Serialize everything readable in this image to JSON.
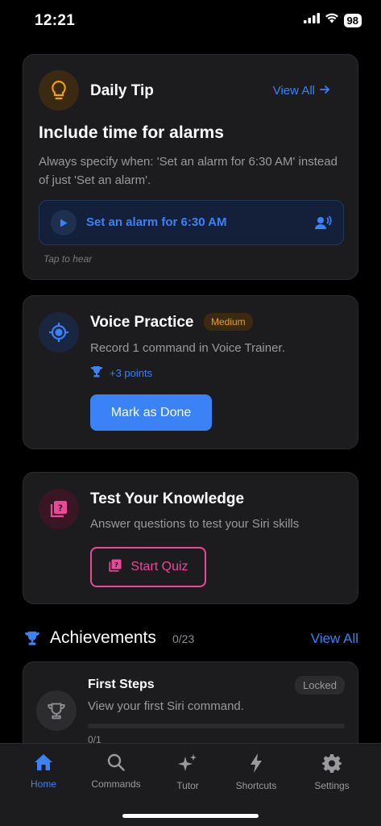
{
  "status": {
    "time": "12:21",
    "battery": "98"
  },
  "daily_tip": {
    "header": "Daily Tip",
    "view_all": "View All",
    "title": "Include time for alarms",
    "description": "Always specify when: 'Set an alarm for 6:30 AM' instead of just 'Set an alarm'.",
    "example": "Set an alarm for 6:30 AM",
    "tap_hint": "Tap to hear"
  },
  "voice_practice": {
    "title": "Voice Practice",
    "difficulty": "Medium",
    "description": "Record 1 command in Voice Trainer.",
    "points": "+3 points",
    "button": "Mark as Done"
  },
  "quiz": {
    "title": "Test Your Knowledge",
    "description": "Answer questions to test your Siri skills",
    "button": "Start Quiz"
  },
  "achievements": {
    "title": "Achievements",
    "count": "0/23",
    "view_all": "View All",
    "items": [
      {
        "title": "First Steps",
        "description": "View your first Siri command.",
        "status": "Locked",
        "progress_label": "0/1",
        "progress": 0
      }
    ]
  },
  "tabs": [
    {
      "label": "Home",
      "icon": "home-icon",
      "active": true
    },
    {
      "label": "Commands",
      "icon": "search-icon",
      "active": false
    },
    {
      "label": "Tutor",
      "icon": "sparkles-icon",
      "active": false
    },
    {
      "label": "Shortcuts",
      "icon": "bolt-icon",
      "active": false
    },
    {
      "label": "Settings",
      "icon": "gear-icon",
      "active": false
    }
  ],
  "colors": {
    "accent": "#3b82f6",
    "warning": "#f59e0b",
    "pink": "#ec4899",
    "card": "#1c1c1e"
  }
}
